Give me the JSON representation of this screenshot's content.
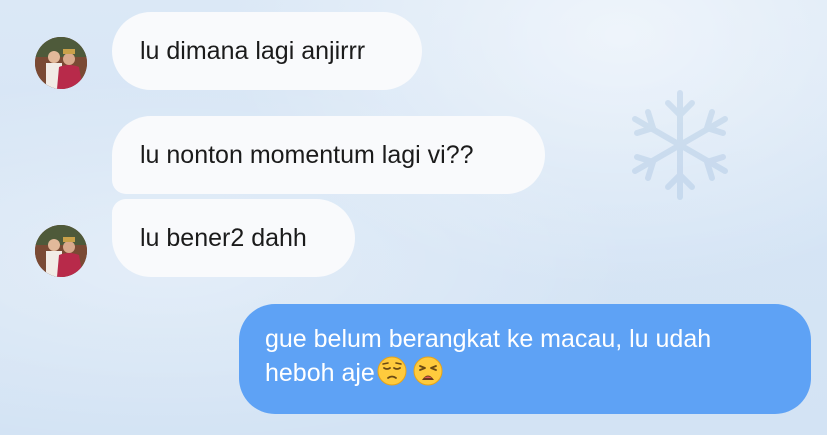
{
  "messages": [
    {
      "direction": "incoming",
      "text": "lu dimana lagi anjirrr",
      "show_avatar": true
    },
    {
      "direction": "incoming",
      "text": "lu nonton momentum lagi vi??",
      "show_avatar": false
    },
    {
      "direction": "incoming",
      "text": "lu bener2 dahh",
      "show_avatar": true
    },
    {
      "direction": "outgoing",
      "text_line1": "gue belum berangkat ke macau, lu udah",
      "text_line2": "heboh aje",
      "emojis": [
        "pensive-face-emoji",
        "weary-face-emoji"
      ]
    }
  ],
  "colors": {
    "background": "#d6e5f5",
    "incoming_bubble": "#f9fafc",
    "outgoing_bubble": "#5ea2f5",
    "incoming_text": "#1b1b1b",
    "outgoing_text": "#ffffff"
  },
  "icons": {
    "avatar": "contact-avatar",
    "background_decoration": "snowflake-icon"
  }
}
